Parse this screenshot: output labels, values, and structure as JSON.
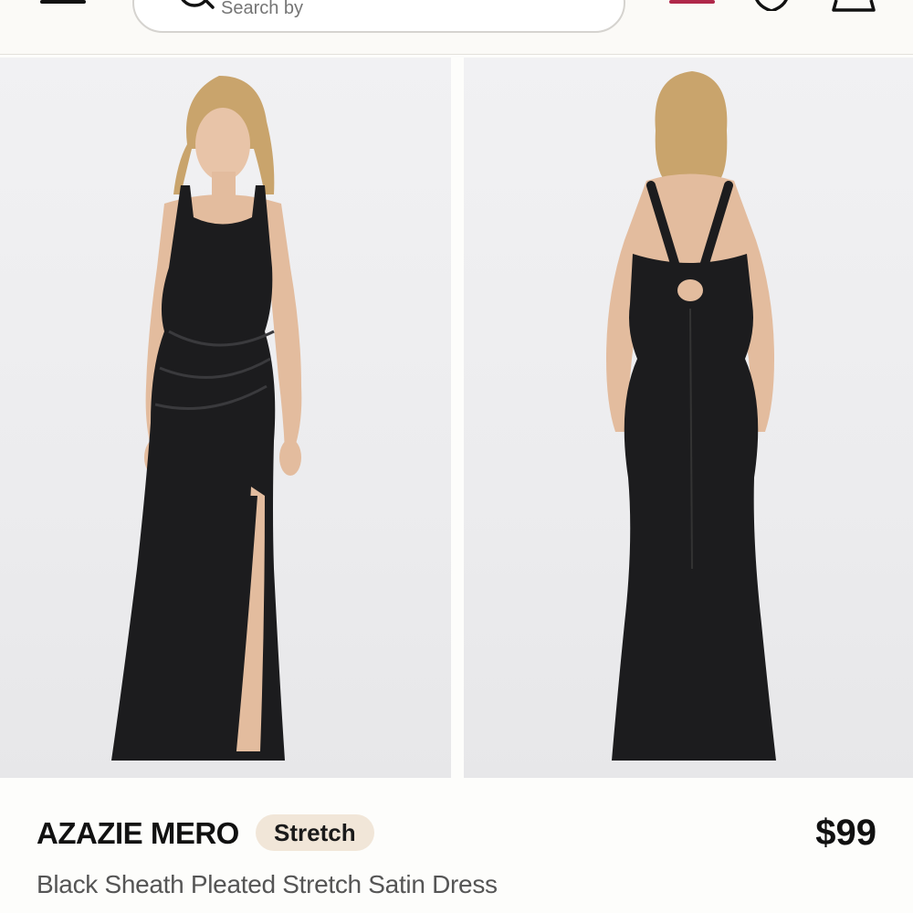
{
  "header": {
    "menu_icon": "hamburger-menu-icon",
    "search": {
      "icon": "search-icon",
      "placeholder": "Search by"
    },
    "account_icon": "account-icon",
    "wishlist_icon": "heart-icon",
    "bag_icon": "shopping-bag-icon",
    "accent_color": "#b0284a"
  },
  "gallery": {
    "images": [
      {
        "name": "front-view",
        "description": "front view of black sheath dress"
      },
      {
        "name": "back-view",
        "description": "back view of black sheath dress"
      }
    ]
  },
  "product": {
    "brand": "AZAZIE MERO",
    "badge": "Stretch",
    "price": "$99",
    "title": "Black Sheath Pleated Stretch Satin Dress",
    "badge_color": "#f1e6d8"
  }
}
